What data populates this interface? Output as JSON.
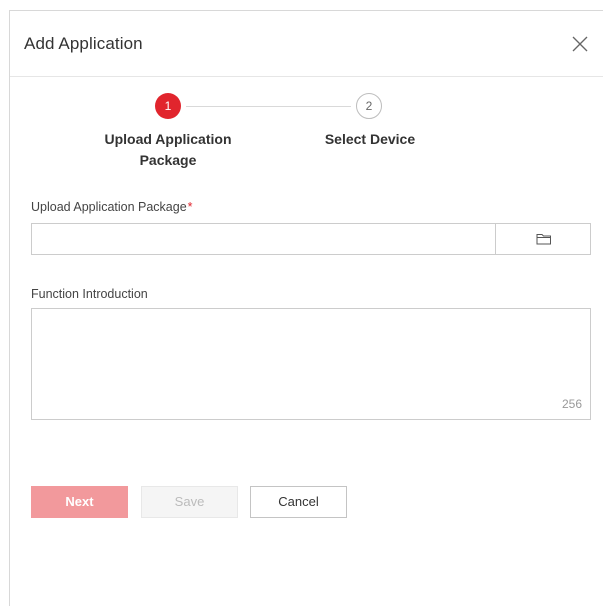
{
  "dialog": {
    "title": "Add Application",
    "close_icon": "close-icon"
  },
  "stepper": {
    "steps": [
      {
        "number": "1",
        "label": "Upload Application Package",
        "state": "active"
      },
      {
        "number": "2",
        "label": "Select Device",
        "state": "inactive"
      }
    ],
    "active_color": "#e1252d"
  },
  "form": {
    "upload": {
      "label": "Upload Application Package",
      "required_mark": "*",
      "value": "",
      "browse_icon": "folder-icon"
    },
    "intro": {
      "label": "Function Introduction",
      "value": "",
      "char_count": "256"
    }
  },
  "buttons": {
    "next_label": "Next",
    "save_label": "Save",
    "cancel_label": "Cancel"
  },
  "colors": {
    "accent": "#e1252d",
    "next_disabled": "#f2999c"
  }
}
